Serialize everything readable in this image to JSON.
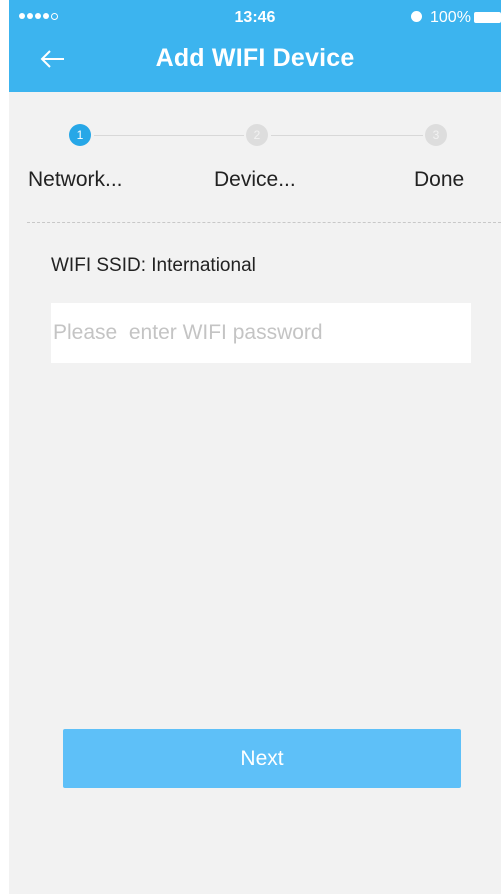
{
  "status_bar": {
    "time": "13:46",
    "battery": "100%",
    "signal_icon": "signal-dots-icon",
    "alarm_icon": "alarm-clock-icon",
    "battery_icon": "battery-full-icon"
  },
  "header": {
    "title": "Add WIFI Device",
    "back_icon": "arrow-left-icon",
    "background_color": "#3cb4ef"
  },
  "steps": [
    {
      "number": "1",
      "label": "Network...",
      "active": true
    },
    {
      "number": "2",
      "label": "Device...",
      "active": false
    },
    {
      "number": "3",
      "label": "Done",
      "active": false
    }
  ],
  "form": {
    "ssid_label": "WIFI SSID: International",
    "password_value": "",
    "password_placeholder": "Please  enter WIFI password"
  },
  "actions": {
    "next_label": "Next",
    "next_color": "#5ec0f8"
  }
}
